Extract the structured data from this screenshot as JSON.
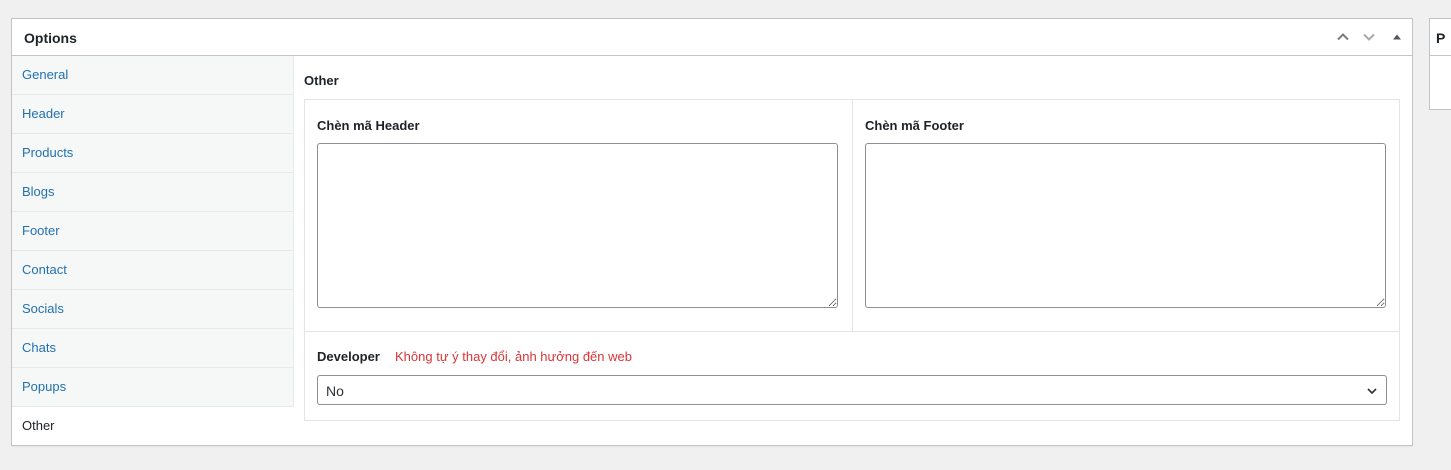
{
  "postbox": {
    "title": "Options",
    "actions": [
      "move-up",
      "move-down",
      "toggle-panel"
    ]
  },
  "tabs": [
    {
      "label": "General",
      "active": false
    },
    {
      "label": "Header",
      "active": false
    },
    {
      "label": "Products",
      "active": false
    },
    {
      "label": "Blogs",
      "active": false
    },
    {
      "label": "Footer",
      "active": false
    },
    {
      "label": "Contact",
      "active": false
    },
    {
      "label": "Socials",
      "active": false
    },
    {
      "label": "Chats",
      "active": false
    },
    {
      "label": "Popups",
      "active": false
    },
    {
      "label": "Other",
      "active": true
    }
  ],
  "section": {
    "title": "Other",
    "header_code": {
      "label": "Chèn mã Header",
      "value": ""
    },
    "footer_code": {
      "label": "Chèn mã Footer",
      "value": ""
    },
    "developer": {
      "label": "Developer",
      "note": "Không tự ý thay đổi, ảnh hưởng đến web",
      "selected": "No"
    }
  },
  "side_box": {
    "title": "P"
  },
  "colors": {
    "link": "#2271b1",
    "warning": "#d63638",
    "background": "#f0f0f1"
  }
}
